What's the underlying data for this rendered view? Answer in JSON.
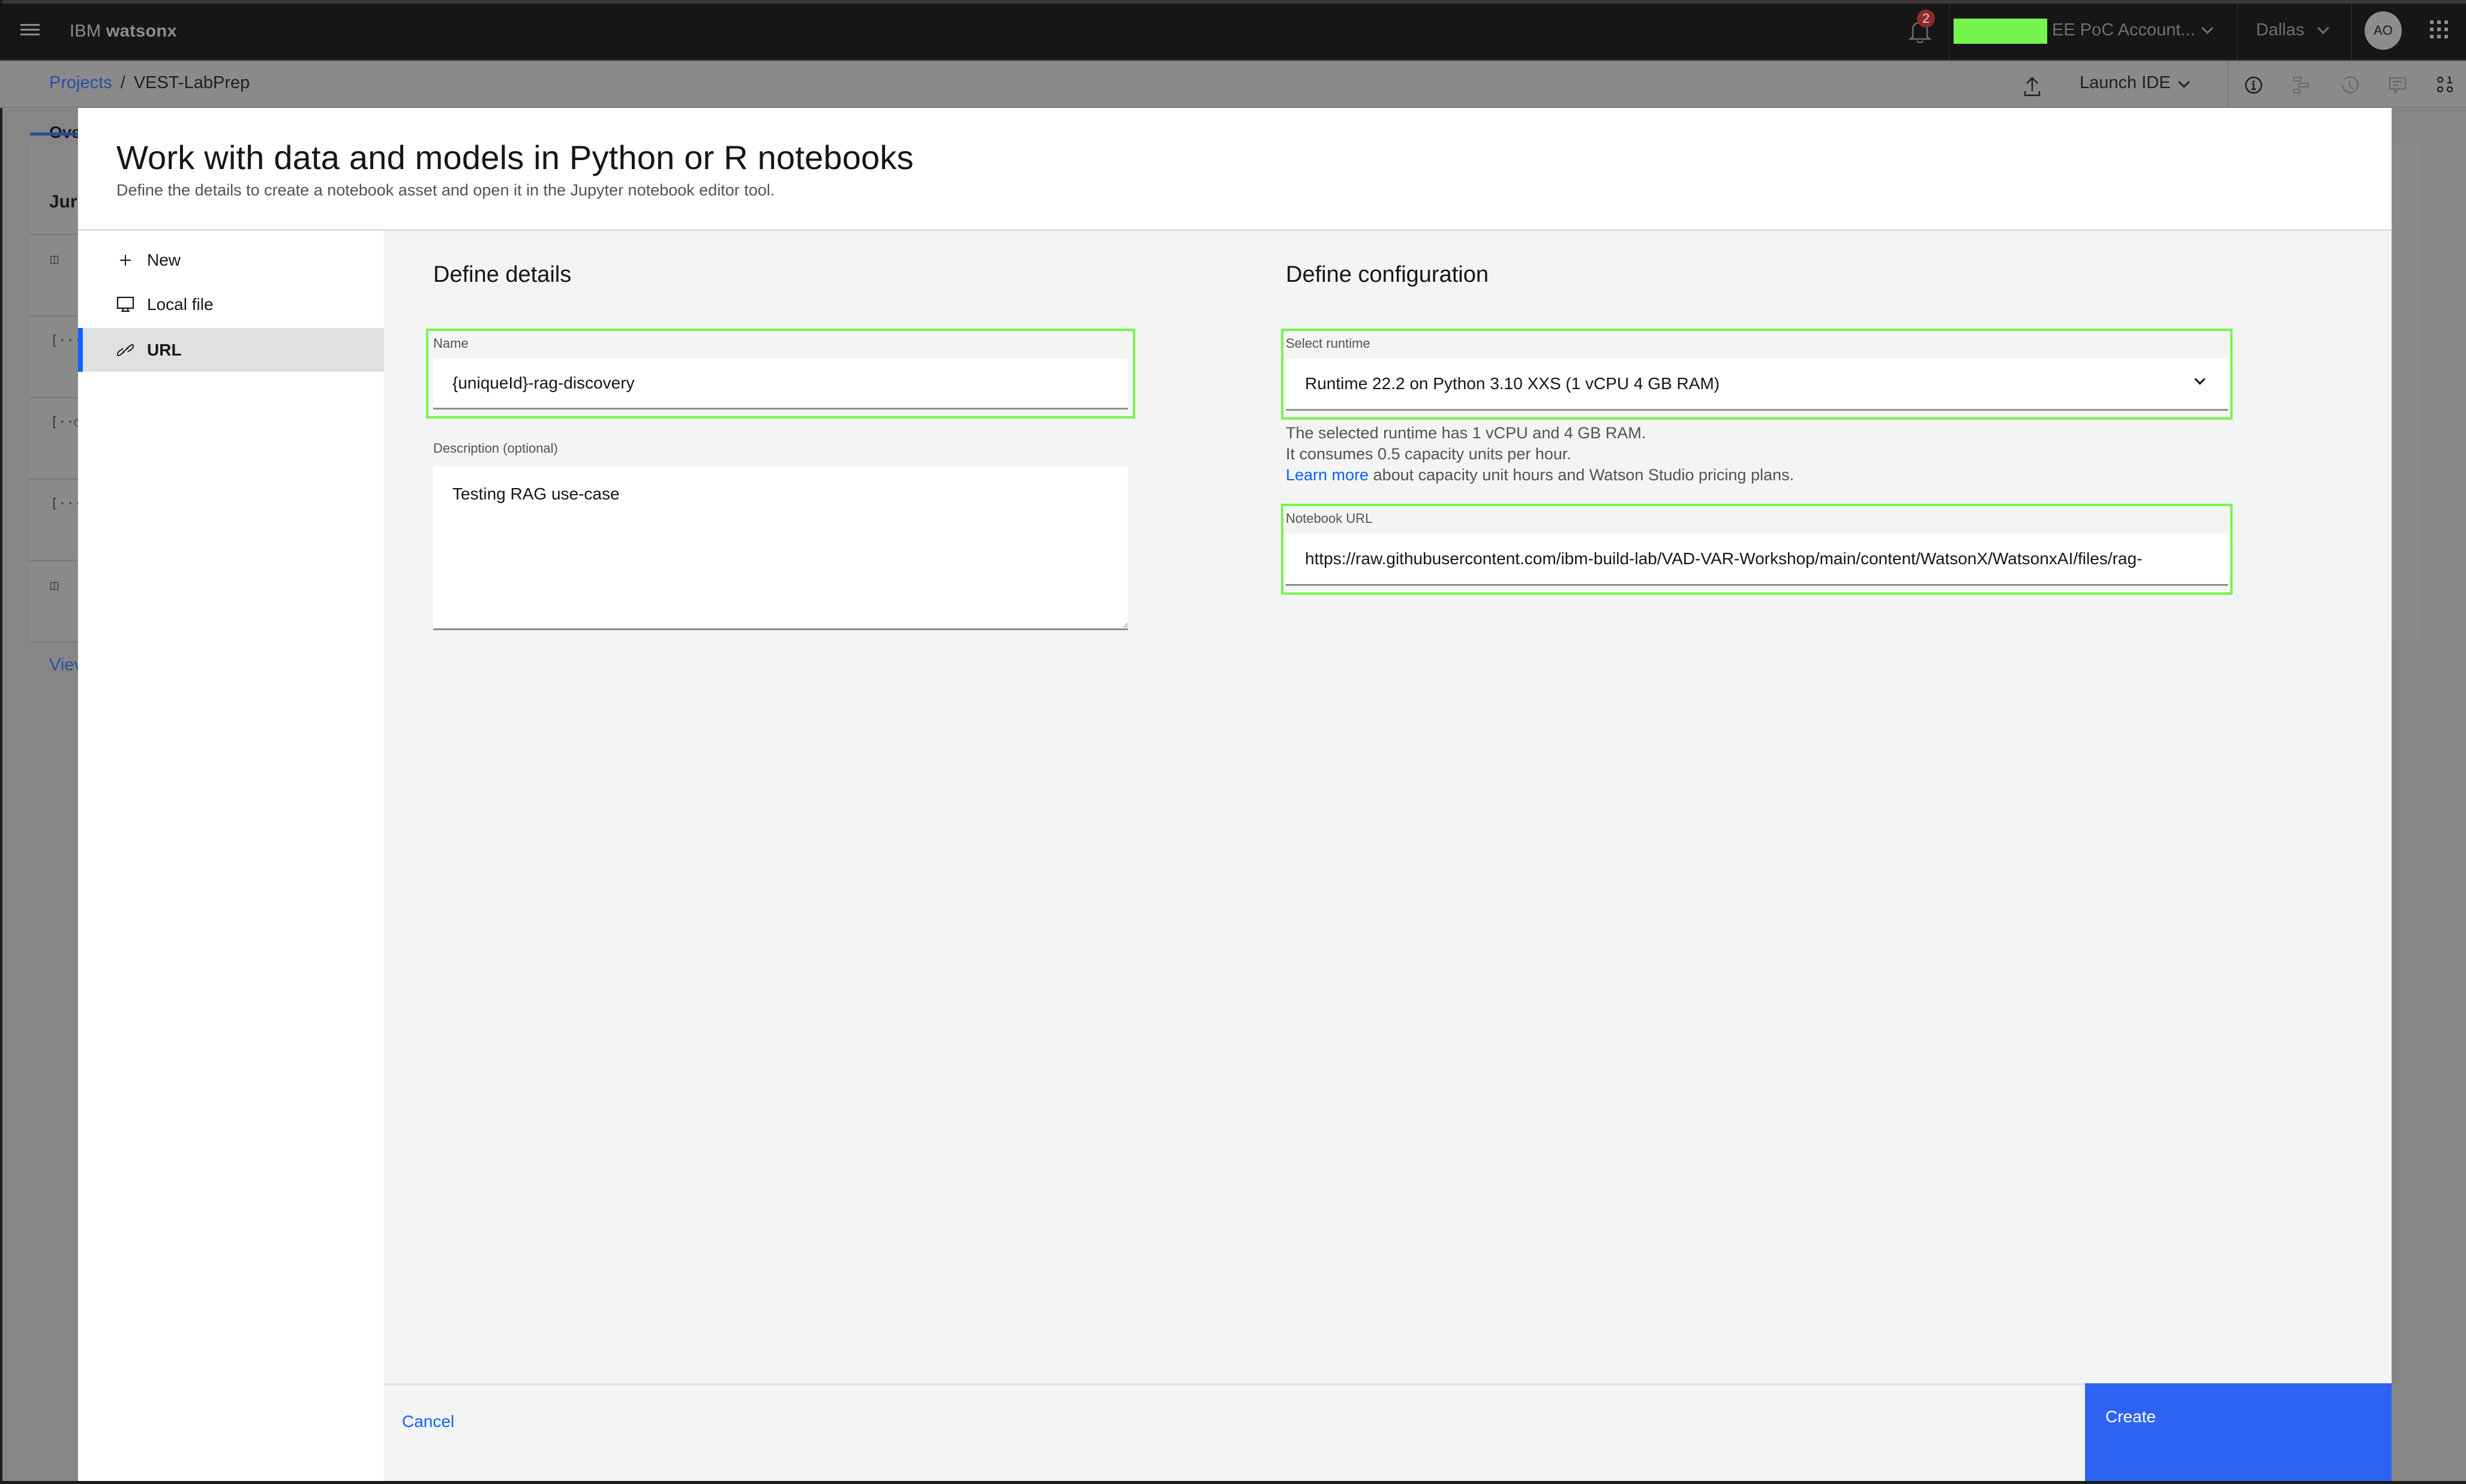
{
  "app": {
    "brand_prefix": "IBM",
    "brand_name": "watsonx",
    "notification_count": "2",
    "account_label": "EE PoC Account...",
    "region": "Dallas",
    "avatar_initials": "AO"
  },
  "breadcrumb": {
    "parent": "Projects",
    "separator": "/",
    "current": "VEST-LabPrep"
  },
  "toolbar": {
    "launch_ide": "Launch IDE",
    "icons": [
      "upload-icon",
      "info-icon",
      "flow-icon",
      "history-icon",
      "comment-icon",
      "data-icon"
    ]
  },
  "background": {
    "tab_label_partial": "Ove",
    "card_title_partial": "Jur",
    "view_link_partial": "Viev",
    "row_icons": [
      "notebook-icon",
      "code-icon",
      "scheduled-job-icon",
      "code-icon",
      "notebook-icon"
    ]
  },
  "modal": {
    "title": "Work with data and models in Python or R notebooks",
    "subtitle": "Define the details to create a notebook asset and open it in the Jupyter notebook editor tool.",
    "sidebar": [
      {
        "label": "New",
        "icon": "plus-icon",
        "active": false
      },
      {
        "label": "Local file",
        "icon": "desktop-icon",
        "active": false
      },
      {
        "label": "URL",
        "icon": "link-icon",
        "active": true
      }
    ],
    "details": {
      "heading": "Define details",
      "name_label": "Name",
      "name_value": "{uniqueId}-rag-discovery",
      "description_label": "Description (optional)",
      "description_value": "Testing RAG use-case"
    },
    "configuration": {
      "heading": "Define configuration",
      "runtime_label": "Select runtime",
      "runtime_value": "Runtime 22.2 on Python 3.10 XXS (1 vCPU 4 GB RAM)",
      "runtime_help_line1": "The selected runtime has 1 vCPU and 4 GB RAM.",
      "runtime_help_line2": "It consumes 0.5 capacity units per hour.",
      "learn_more": "Learn more",
      "runtime_help_line3": " about capacity unit hours and Watson Studio pricing plans.",
      "url_label": "Notebook URL",
      "url_value": "https://raw.githubusercontent.com/ibm-build-lab/VAD-VAR-Workshop/main/content/WatsonX/WatsonxAI/files/rag-"
    },
    "footer": {
      "cancel": "Cancel",
      "create": "Create"
    }
  },
  "colors": {
    "primary": "#0f62fe",
    "create_button": "#2d63f5",
    "highlight_outline": "#77f54f",
    "header_bg": "#161616",
    "overlay": "#8a8a8a"
  }
}
